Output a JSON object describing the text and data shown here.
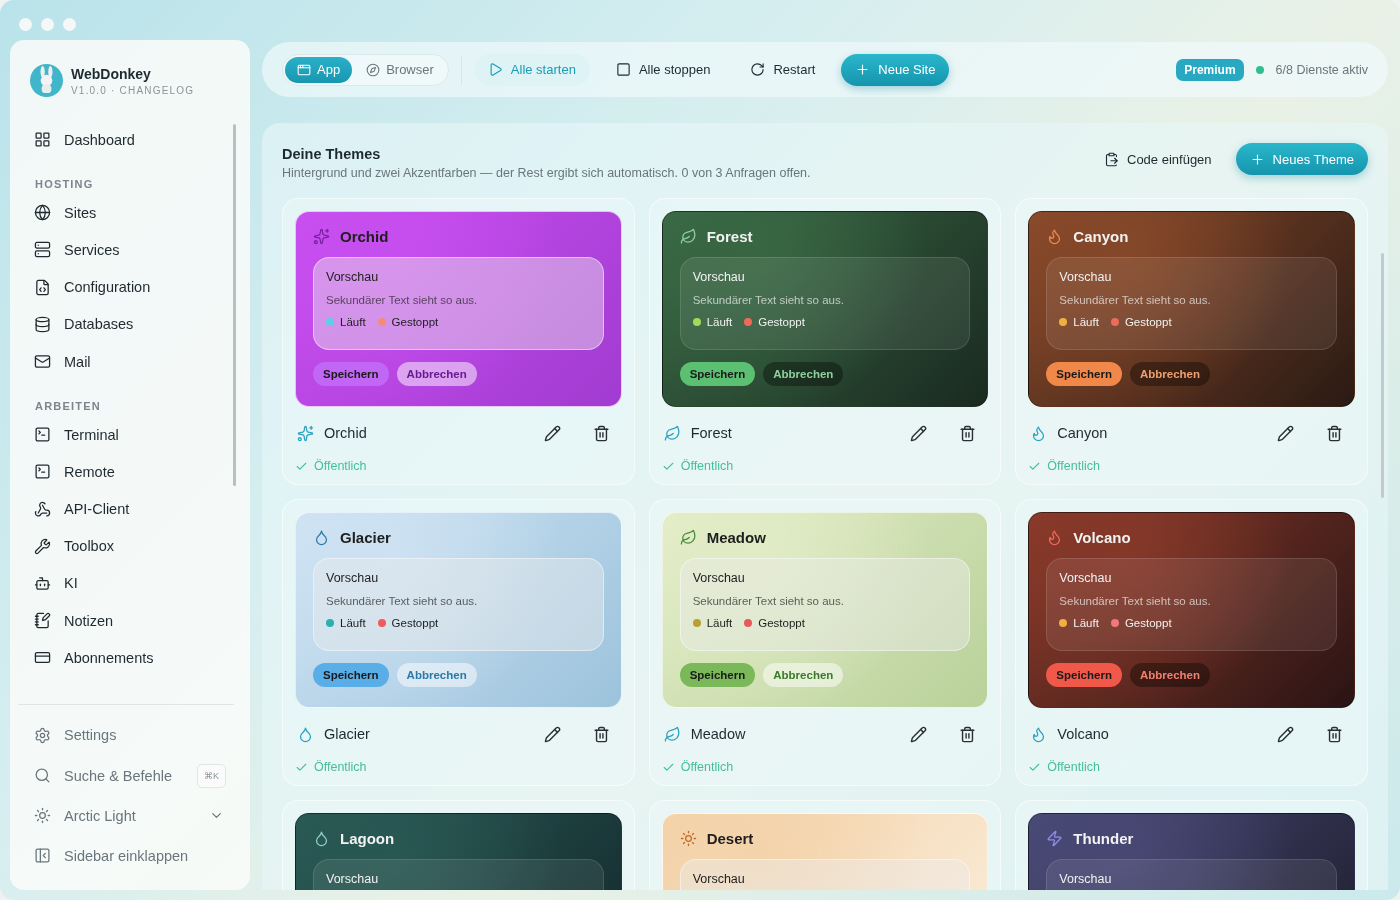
{
  "sidebar": {
    "brand": {
      "name": "WebDonkey",
      "subtitle": "V1.0.0 · CHANGELOG"
    },
    "sections": [
      {
        "items": [
          {
            "label": "Dashboard"
          }
        ]
      },
      {
        "heading": "HOSTING",
        "items": [
          {
            "label": "Sites"
          },
          {
            "label": "Services"
          },
          {
            "label": "Configuration"
          },
          {
            "label": "Databases"
          },
          {
            "label": "Mail"
          }
        ]
      },
      {
        "heading": "ARBEITEN",
        "items": [
          {
            "label": "Terminal"
          },
          {
            "label": "Remote"
          },
          {
            "label": "API-Client"
          },
          {
            "label": "Toolbox"
          },
          {
            "label": "KI"
          },
          {
            "label": "Notizen"
          },
          {
            "label": "Abonnements"
          }
        ]
      }
    ],
    "footer": [
      {
        "label": "Settings",
        "kind": "link"
      },
      {
        "label": "Suche & Befehle",
        "kind": "search",
        "shortcut": "⌘K"
      },
      {
        "label": "Arctic Light",
        "kind": "dropdown"
      },
      {
        "label": "Sidebar einklappen",
        "kind": "link"
      }
    ]
  },
  "toolbar": {
    "views": [
      {
        "label": "App",
        "selected": true
      },
      {
        "label": "Browser",
        "selected": false
      }
    ],
    "actions": [
      {
        "label": "Alle starten",
        "kind": "soft"
      },
      {
        "label": "Alle stoppen",
        "kind": "plain"
      },
      {
        "label": "Restart",
        "kind": "plain"
      },
      {
        "label": "Neue Site",
        "kind": "primary"
      }
    ],
    "badge": "Premium",
    "status": {
      "text": "6/8 Dienste aktiv",
      "color": "#2fbf8f"
    }
  },
  "themes_panel": {
    "title": "Deine Themes",
    "subtitle": "Hintergrund und zwei Akzentfarben — der Rest ergibt sich automatisch. 0 von 3 Anfragen offen.",
    "actions": [
      {
        "label": "Code einfügen",
        "kind": "plain"
      },
      {
        "label": "Neues Theme",
        "kind": "primary"
      }
    ],
    "themes": [
      {
        "name": "Orchid",
        "color": "#c94ff0",
        "preview": {
          "title": "Vorschau",
          "text": "Sekundärer Text sieht so aus.",
          "legend": [
            {
              "label": "Läuft",
              "color": "#5ccfe6"
            },
            {
              "label": "Gestoppt",
              "color": "#f58a7a"
            }
          ],
          "buttons": [
            "Speichern",
            "Abbrechen"
          ]
        },
        "footer_name": "Orchid",
        "visibility": "Öffentlich"
      },
      {
        "name": "Forest",
        "color": "#3a6a45",
        "preview": {
          "title": "Vorschau",
          "text": "Sekundärer Text sieht so aus.",
          "legend": [
            {
              "label": "Läuft",
              "color": "#a6d95a"
            },
            {
              "label": "Gestoppt",
              "color": "#f06a5a"
            }
          ],
          "buttons": [
            "Speichern",
            "Abbrechen"
          ]
        },
        "footer_name": "Forest",
        "visibility": "Öffentlich"
      },
      {
        "name": "Canyon",
        "color": "#8a4a2a",
        "preview": {
          "title": "Vorschau",
          "text": "Sekundärer Text sieht so aus.",
          "legend": [
            {
              "label": "Läuft",
              "color": "#f0b040"
            },
            {
              "label": "Gestoppt",
              "color": "#f06a5a"
            }
          ],
          "buttons": [
            "Speichern",
            "Abbrechen"
          ]
        },
        "footer_name": "Canyon",
        "visibility": "Öffentlich"
      },
      {
        "name": "Glacier",
        "color": "#cfe3f3",
        "preview": {
          "title": "Vorschau",
          "text": "Sekundärer Text sieht so aus.",
          "legend": [
            {
              "label": "Läuft",
              "color": "#2ab0b0"
            },
            {
              "label": "Gestoppt",
              "color": "#f05a5a"
            }
          ],
          "buttons": [
            "Speichern",
            "Abbrechen"
          ]
        },
        "footer_name": "Glacier",
        "visibility": "Öffentlich"
      },
      {
        "name": "Meadow",
        "color": "#e3edc8",
        "preview": {
          "title": "Vorschau",
          "text": "Sekundärer Text sieht so aus.",
          "legend": [
            {
              "label": "Läuft",
              "color": "#b8a030"
            },
            {
              "label": "Gestoppt",
              "color": "#e85a5a"
            }
          ],
          "buttons": [
            "Speichern",
            "Abbrechen"
          ]
        },
        "footer_name": "Meadow",
        "visibility": "Öffentlich"
      },
      {
        "name": "Volcano",
        "color": "#8a3a2a",
        "preview": {
          "title": "Vorschau",
          "text": "Sekundärer Text sieht so aus.",
          "legend": [
            {
              "label": "Läuft",
              "color": "#f0b040"
            },
            {
              "label": "Gestoppt",
              "color": "#f07a7a"
            }
          ],
          "buttons": [
            "Speichern",
            "Abbrechen"
          ]
        },
        "footer_name": "Volcano",
        "visibility": "Öffentlich"
      },
      {
        "name": "Lagoon",
        "color": "#2a5a55",
        "preview": {
          "title": "Vorschau"
        }
      },
      {
        "name": "Desert",
        "color": "#f3d2a8",
        "preview": {
          "title": "Vorschau"
        }
      },
      {
        "name": "Thunder",
        "color": "#4a4a78",
        "preview": {
          "title": "Vorschau"
        }
      }
    ]
  }
}
